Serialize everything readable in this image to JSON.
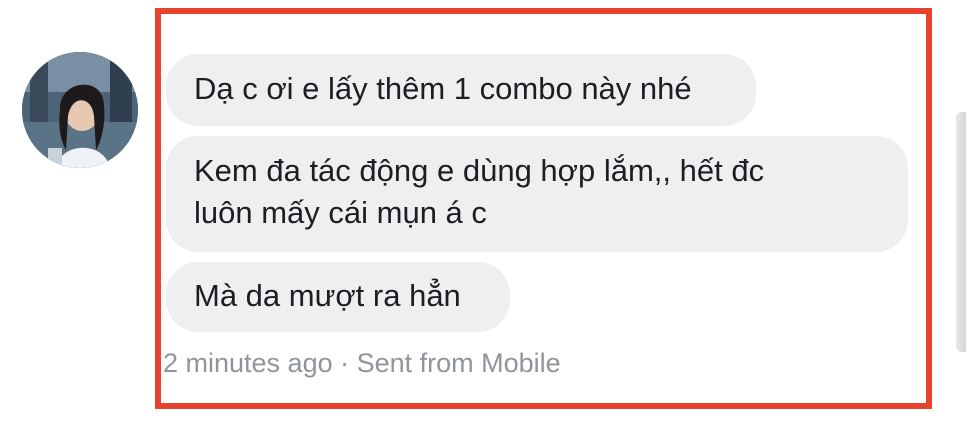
{
  "sender": {
    "avatar_icon": "person-photo-avatar"
  },
  "messages": [
    {
      "lines": [
        "Dạ c ơi e lấy thêm 1 combo này nhé"
      ]
    },
    {
      "lines": [
        "Kem đa tác động e dùng hợp lắm,, hết đc",
        "luôn mấy cái mụn á c"
      ]
    },
    {
      "lines": [
        "Mà da mượt ra hẳn"
      ]
    }
  ],
  "meta": {
    "time_and_source": "2 minutes ago · Sent from Mobile"
  },
  "colors": {
    "highlight_border": "#e8432f",
    "bubble_background": "#eeeff1",
    "meta_text": "#90949c"
  }
}
